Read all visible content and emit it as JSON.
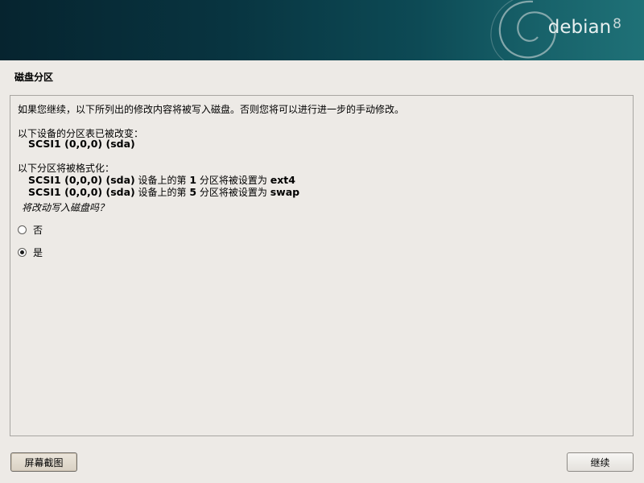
{
  "header": {
    "brand": "debian",
    "version": "8"
  },
  "page_title": "磁盘分区",
  "content": {
    "intro": "如果您继续，以下所列出的修改内容将被写入磁盘。否则您将可以进行进一步的手动修改。",
    "partition_table_heading": "以下设备的分区表已被改变：",
    "partition_table_device": "SCSI1 (0,0,0) (sda)",
    "format_heading": "以下分区将被格式化：",
    "format_items": [
      {
        "device": "SCSI1 (0,0,0) (sda)",
        "middle": " 设备上的第 ",
        "number": "1",
        "tail": " 分区将被设置为 ",
        "fs": "ext4"
      },
      {
        "device": "SCSI1 (0,0,0) (sda)",
        "middle": " 设备上的第 ",
        "number": "5",
        "tail": " 分区将被设置为 ",
        "fs": "swap"
      }
    ],
    "question": "将改动写入磁盘吗？",
    "options": [
      {
        "label": "否",
        "selected": false
      },
      {
        "label": "是",
        "selected": true
      }
    ]
  },
  "buttons": {
    "screenshot": "屏幕截图",
    "continue": "继续"
  }
}
